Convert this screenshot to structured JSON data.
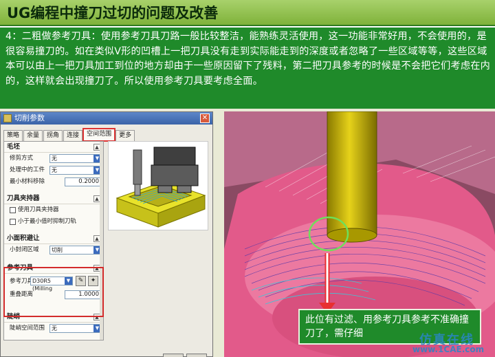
{
  "slide": {
    "title": "UG编程中撞刀过切的问题及改善",
    "description": "4：二粗做参考刀具：使用参考刀具刀路一般比较整洁，能熟练灵活使用，这一功能非常好用，不会使用的，是很容易撞刀的。如在类似V形的凹槽上一把刀具没有走到实际能走到的深度或者忽略了一些区域等等，这些区域本可以由上一把刀具加工到位的地方却由于一些原因留下了残料，第二把刀具参考的时候是不会把它们考虑在内的，这样就会出现撞刀了。所以使用参考刀具要考虑全面。"
  },
  "dialog": {
    "title": "切削参数",
    "tabs": [
      {
        "label": "策略"
      },
      {
        "label": "余量"
      },
      {
        "label": "拐角"
      },
      {
        "label": "连接"
      },
      {
        "label": "空间范围"
      },
      {
        "label": "更多"
      }
    ],
    "blank_section": {
      "title": "毛坯",
      "trim_label": "修剪方式",
      "trim_value": "无",
      "ipw_label": "处理中的工件",
      "ipw_value": "无",
      "min_removal_label": "最小材料移除",
      "min_removal_value": "0.2000"
    },
    "holder_section": {
      "title": "刀具夹持器",
      "use_holder_label": "使用刀具夹持器",
      "small_suppress_label": "小于最小值时抑制刀轨"
    },
    "small_area_section": {
      "title": "小面积避让",
      "closed_area_label": "小封闭区域",
      "closed_area_value": "切削"
    },
    "ref_tool_section": {
      "title": "参考刀具",
      "ref_tool_label": "参考刀具",
      "ref_tool_value": "D30R5 (Milling",
      "overlap_label": "重叠距离",
      "overlap_value": "1.0000"
    },
    "steep_section": {
      "title": "陡峭",
      "steep_range_label": "陡峭空间范围",
      "steep_range_value": "无"
    }
  },
  "callout": {
    "text": "此位有过滤、用参考刀具参考不准确撞刀了，需仔细"
  },
  "watermark": {
    "text": "仿真在线",
    "url": "www.1CAE.com"
  },
  "colors": {
    "title_bar": "#8cc04a",
    "description_bg": "#1f8a2a",
    "highlight_red": "#d32b2b",
    "tool_yellow": "#c8b400",
    "part_pink": "#e25a8a"
  }
}
